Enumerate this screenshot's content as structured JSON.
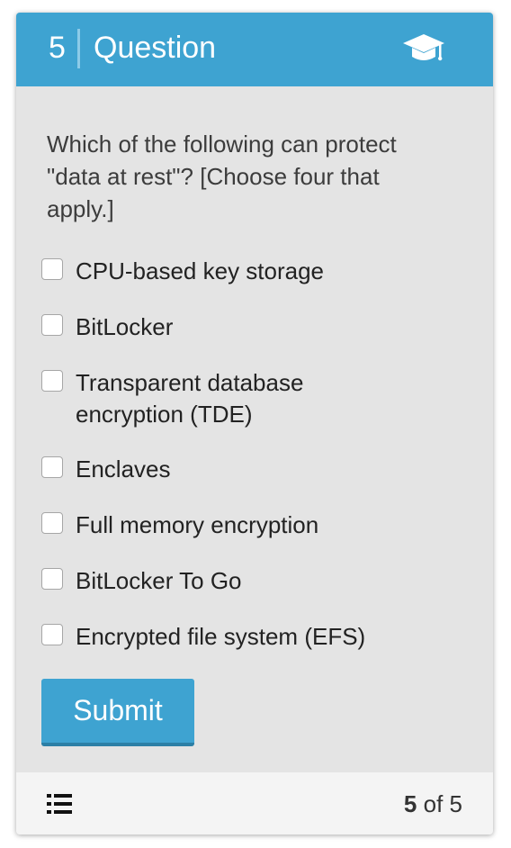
{
  "header": {
    "question_number": "5",
    "title": "Question",
    "icon": "graduation-cap-icon",
    "accent_color": "#3ea3d1"
  },
  "question": {
    "prompt": "Which of the following can protect \"data at rest\"? [Choose four that apply.]",
    "options": [
      {
        "label": "CPU-based key storage",
        "checked": false
      },
      {
        "label": "BitLocker",
        "checked": false
      },
      {
        "label": "Transparent database encryption (TDE)",
        "checked": false
      },
      {
        "label": "Enclaves",
        "checked": false
      },
      {
        "label": "Full memory encryption",
        "checked": false
      },
      {
        "label": "BitLocker To Go",
        "checked": false
      },
      {
        "label": "Encrypted file system (EFS)",
        "checked": false
      }
    ]
  },
  "submit_label": "Submit",
  "footer": {
    "list_icon": "list-icon",
    "current": "5",
    "of_text": "of",
    "total": "5"
  }
}
